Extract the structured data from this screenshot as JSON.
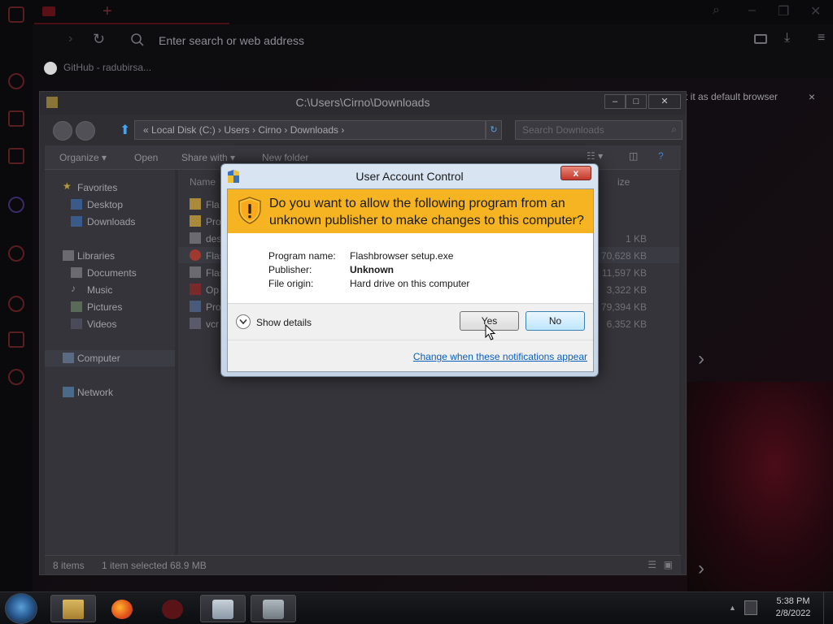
{
  "browser": {
    "url_placeholder": "Enter search or web address",
    "bookmark_label": "GitHub - radubirsa...",
    "default_banner_text": "t it as default browser",
    "default_banner_close": "×",
    "new_tab": "+",
    "minimize": "–",
    "maximize": "❐",
    "close": "✕"
  },
  "explorer": {
    "title": "C:\\Users\\Cirno\\Downloads",
    "address_path": "«  Local Disk (C:)  ›  Users  ›  Cirno  ›  Downloads  ›",
    "search_placeholder": "Search Downloads",
    "toolbar": {
      "organize": "Organize ▾",
      "open": "Open",
      "share_with": "Share with ▾",
      "new_folder": "New folder"
    },
    "column_header_name": "Name",
    "column_header_size": "ize",
    "nav": {
      "favorites": "Favorites",
      "desktop": "Desktop",
      "downloads": "Downloads",
      "libraries": "Libraries",
      "documents": "Documents",
      "music": "Music",
      "pictures": "Pictures",
      "videos": "Videos",
      "computer": "Computer",
      "network": "Network"
    },
    "files": [
      {
        "name": "Fla",
        "size": ""
      },
      {
        "name": "Pro",
        "size": ""
      },
      {
        "name": "des",
        "size": "1 KB"
      },
      {
        "name": "Flas",
        "size": "70,628 KB"
      },
      {
        "name": "Flas",
        "size": "11,597 KB"
      },
      {
        "name": "Op",
        "size": "3,322 KB"
      },
      {
        "name": "Pro",
        "size": "79,394 KB"
      },
      {
        "name": "vcr",
        "size": "6,352 KB"
      }
    ],
    "status": {
      "count": "8 items",
      "selected": "1 item selected  68.9 MB"
    }
  },
  "uac": {
    "title": "User Account Control",
    "close_label": "x",
    "question": "Do you want to allow the following program from an unknown publisher to make changes to this computer?",
    "program_name_label": "Program name:",
    "program_name_value": "Flashbrowser setup.exe",
    "publisher_label": "Publisher:",
    "publisher_value": "Unknown",
    "file_origin_label": "File origin:",
    "file_origin_value": "Hard drive on this computer",
    "show_details": "Show details",
    "yes": "Yes",
    "no": "No",
    "change_link": "Change when these notifications appear",
    "banner_color": "#f6b423"
  },
  "taskbar": {
    "clock_time": "5:38 PM",
    "clock_date": "2/8/2022"
  }
}
